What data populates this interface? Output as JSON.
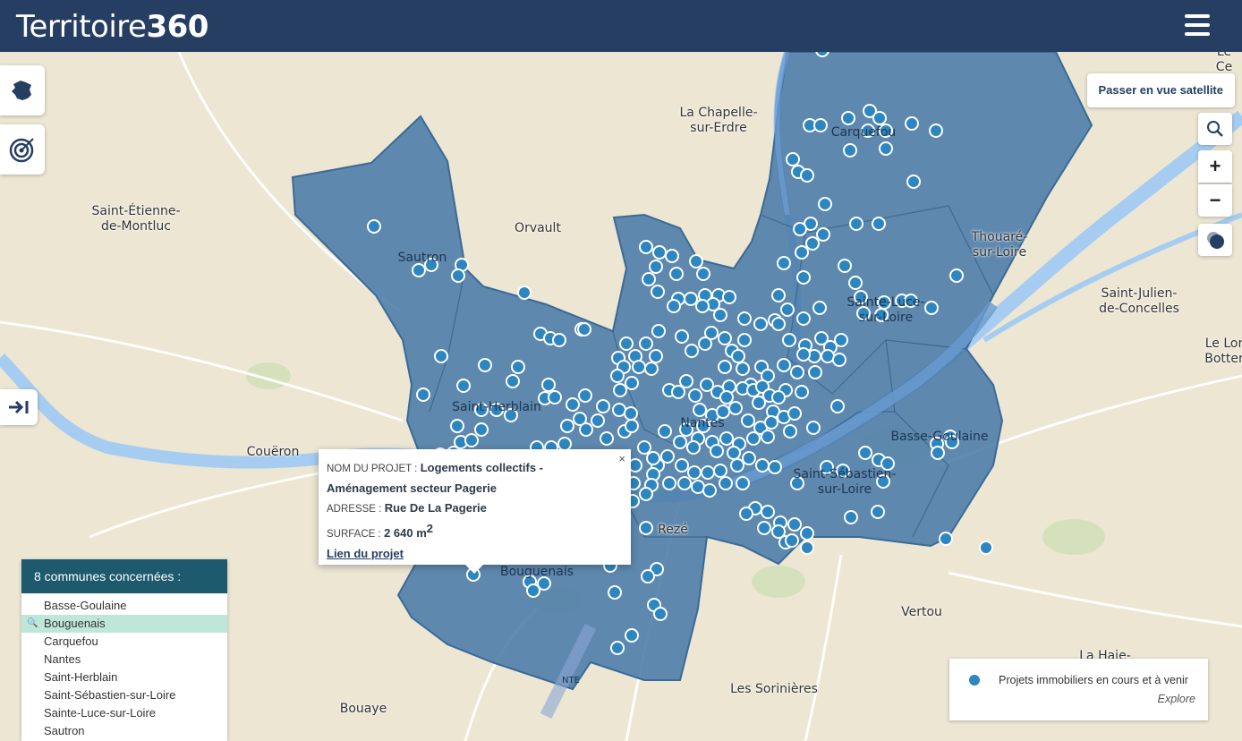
{
  "header": {
    "logo_text": "Territoire",
    "logo_num": "360",
    "menu_icon": "hamburger-menu-icon"
  },
  "tools": {
    "france_icon": "france-map-icon",
    "target_icon": "target-icon",
    "collapse_icon": "collapse-panel-icon"
  },
  "controls": {
    "satellite_label": "Passer en vue satellite",
    "search_icon": "search-icon",
    "zoom_in": "+",
    "zoom_out": "−",
    "layer_icon": "layer-toggle-icon"
  },
  "map": {
    "places": [
      {
        "name": "La Chapelle-\nsur-Erdre",
        "inpoly": false
      },
      {
        "name": "Saint-Étienne-\nde-Montluc",
        "inpoly": false
      },
      {
        "name": "Orvault",
        "inpoly": false
      },
      {
        "name": "Sautron",
        "inpoly": true
      },
      {
        "name": "Carquefou",
        "inpoly": true
      },
      {
        "name": "Thouaré-\nsur-Loire",
        "inpoly": false
      },
      {
        "name": "Saint-Julien-\nde-Concelles",
        "inpoly": false
      },
      {
        "name": "Sainte-Luce-\nsur-Loire",
        "inpoly": true
      },
      {
        "name": "Saint-Herblain",
        "inpoly": true
      },
      {
        "name": "Nantes",
        "inpoly": true
      },
      {
        "name": "Couëron",
        "inpoly": false
      },
      {
        "name": "Basse-Goulaine",
        "inpoly": true
      },
      {
        "name": "Saint-Sébastien-\nsur-Loire",
        "inpoly": true
      },
      {
        "name": "Rezé",
        "inpoly": false
      },
      {
        "name": "Bouguenais",
        "inpoly": true
      },
      {
        "name": "Vertou",
        "inpoly": false
      },
      {
        "name": "Les Sorinières",
        "inpoly": false
      },
      {
        "name": "Bouaye",
        "inpoly": false
      },
      {
        "name": "La Haie-",
        "inpoly": false
      },
      {
        "name": "Le Lor\nBotter",
        "inpoly": false
      },
      {
        "name": "Le Ce",
        "inpoly": false
      },
      {
        "name": "NTE",
        "inpoly": true
      }
    ],
    "colors": {
      "background": "#ece6d3",
      "polygon": "#4a7ba8",
      "water": "#a6cdf1",
      "marker": "#2e86c1"
    }
  },
  "popup": {
    "name_label": "NOM DU PROJET :",
    "name_value_1": "Logements collectifs -",
    "name_value_2": "Aménagement secteur Pagerie",
    "address_label": "ADRESSE :",
    "address_value": "Rue De La Pagerie",
    "surface_label": "SURFACE :",
    "surface_value": "2 640 m",
    "surface_unit_sup": "2",
    "link_label": "Lien du projet",
    "close": "×"
  },
  "communes": {
    "title": "8 communes concernées :",
    "items": [
      {
        "label": "Basse-Goulaine",
        "selected": false
      },
      {
        "label": "Bouguenais",
        "selected": true
      },
      {
        "label": "Carquefou",
        "selected": false
      },
      {
        "label": "Nantes",
        "selected": false
      },
      {
        "label": "Saint-Herblain",
        "selected": false
      },
      {
        "label": "Saint-Sébastien-sur-Loire",
        "selected": false
      },
      {
        "label": "Sainte-Luce-sur-Loire",
        "selected": false
      },
      {
        "label": "Sautron",
        "selected": false
      }
    ]
  },
  "legend": {
    "label": "Projets immobiliers en cours et à venir",
    "source": "Explore"
  }
}
